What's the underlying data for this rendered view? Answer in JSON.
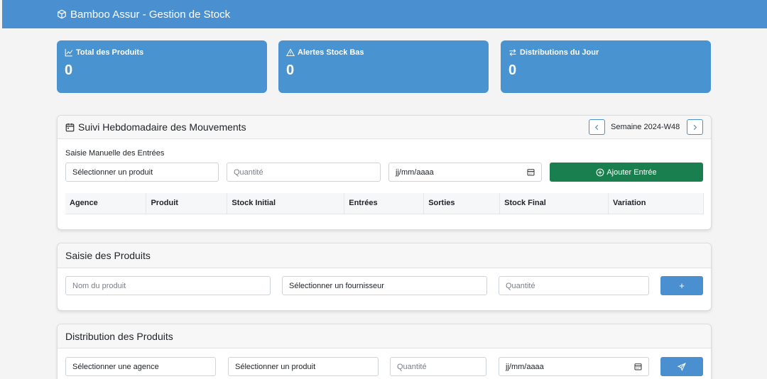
{
  "app": {
    "title": "Bamboo Assur - Gestion de Stock",
    "icon": "box-icon"
  },
  "stats": [
    {
      "label": "Total des Produits",
      "value": "0",
      "icon": "chart-line-icon"
    },
    {
      "label": "Alertes Stock Bas",
      "value": "0",
      "icon": "warning-icon"
    },
    {
      "label": "Distributions du Jour",
      "value": "0",
      "icon": "arrows-swap-icon"
    }
  ],
  "weekly": {
    "title": "Suivi Hebdomadaire des Mouvements",
    "week_label": "Semaine 2024-W48",
    "section_label": "Saisie Manuelle des Entrées",
    "product_select": "Sélectionner un produit",
    "quantity_placeholder": "Quantité",
    "date_placeholder": "jj/mm/aaaa",
    "add_button": "Ajouter Entrée",
    "columns": [
      "Agence",
      "Produit",
      "Stock Initial",
      "Entrées",
      "Sorties",
      "Stock Final",
      "Variation"
    ]
  },
  "products": {
    "title": "Saisie des Produits",
    "name_placeholder": "Nom du produit",
    "supplier_select": "Sélectionner un fournisseur",
    "quantity_placeholder": "Quantité",
    "add_button": "+"
  },
  "distribution": {
    "title": "Distribution des Produits",
    "agency_select": "Sélectionner une agence",
    "product_select": "Sélectionner un produit",
    "quantity_placeholder": "Quantité",
    "date_placeholder": "jj/mm/aaaa"
  },
  "colors": {
    "primary": "#4a90d0",
    "success": "#1a7f4e",
    "stat_card": "#4a93d1"
  }
}
